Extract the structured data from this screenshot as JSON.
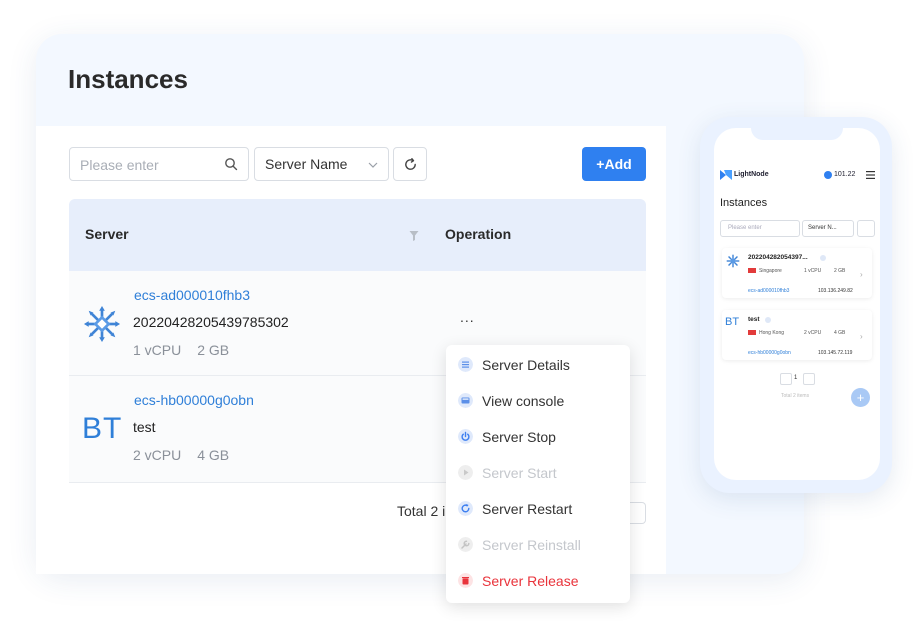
{
  "page": {
    "title": "Instances"
  },
  "toolbar": {
    "search_placeholder": "Please enter",
    "filter_select_value": "Server Name",
    "add_label": "+Add"
  },
  "table": {
    "headers": {
      "server": "Server",
      "operation": "Operation"
    },
    "rows": [
      {
        "id": "ecs-ad000010fhb3",
        "name": "20220428205439785302",
        "cpu": "1 vCPU",
        "memory": "2 GB",
        "logo": "snowflake-logo-icon"
      },
      {
        "id": "ecs-hb00000g0obn",
        "name": "test",
        "cpu": "2 vCPU",
        "memory": "4 GB",
        "logo_text": "BT"
      }
    ],
    "more_label": "...",
    "footer_total": "Total 2 i"
  },
  "operation_menu": {
    "items": [
      {
        "label": "Server Details",
        "icon": "list-icon",
        "state": "enabled"
      },
      {
        "label": "View console",
        "icon": "console-icon",
        "state": "enabled"
      },
      {
        "label": "Server Stop",
        "icon": "power-icon",
        "state": "enabled"
      },
      {
        "label": "Server Start",
        "icon": "play-icon",
        "state": "disabled"
      },
      {
        "label": "Server Restart",
        "icon": "restart-icon",
        "state": "enabled"
      },
      {
        "label": "Server Reinstall",
        "icon": "wrench-icon",
        "state": "disabled"
      },
      {
        "label": "Server Release",
        "icon": "trash-icon",
        "state": "danger"
      }
    ]
  },
  "mobile": {
    "brand": "LightNode",
    "balance": "101.22",
    "title": "Instances",
    "search_placeholder": "Please enter",
    "select_value": "Server N...",
    "cards": [
      {
        "name": "202204282054397...",
        "location": "Singapore",
        "cpu": "1 vCPU",
        "memory": "2 GB",
        "id": "ecs-ad000010fhb3",
        "ip": "103.136.249.82"
      },
      {
        "name": "test",
        "location": "Hong Kong",
        "cpu": "2 vCPU",
        "memory": "4 GB",
        "id": "ecs-hb00000g0obn",
        "ip": "103.145.72.119",
        "logo_text": "BT"
      }
    ],
    "page_number": "1",
    "total": "Total 2 items",
    "fab_label": "+"
  },
  "colors": {
    "primary": "#2f80f0",
    "danger": "#e9333b",
    "link": "#2f7fd8",
    "header_bg": "#e7eefb"
  }
}
